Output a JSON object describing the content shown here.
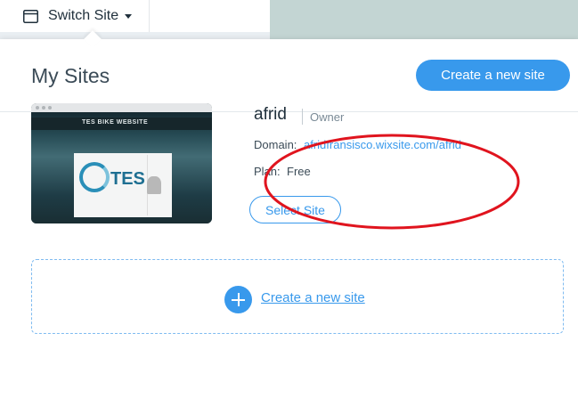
{
  "topbar": {
    "switch_label": "Switch Site",
    "window_icon": "browser-window-icon",
    "caret_icon": "caret-down-icon"
  },
  "panel": {
    "title": "My Sites",
    "create_button_label": "Create a new site"
  },
  "site": {
    "name": "afrid",
    "role": "Owner",
    "domain_label": "Domain:",
    "domain_url": "afridfransisco.wixsite.com/afrid",
    "plan_label": "Plan:",
    "plan_value": "Free",
    "select_button_label": "Select Site",
    "thumbnail": {
      "header_text": "TES BIKE WEBSITE",
      "logo_text": "TES"
    }
  },
  "create_area": {
    "link_label": "Create a new site",
    "icon": "plus-circle-icon"
  },
  "colors": {
    "accent": "#3899ec",
    "annotation": "#e0141e",
    "text_dark": "#20303c"
  }
}
